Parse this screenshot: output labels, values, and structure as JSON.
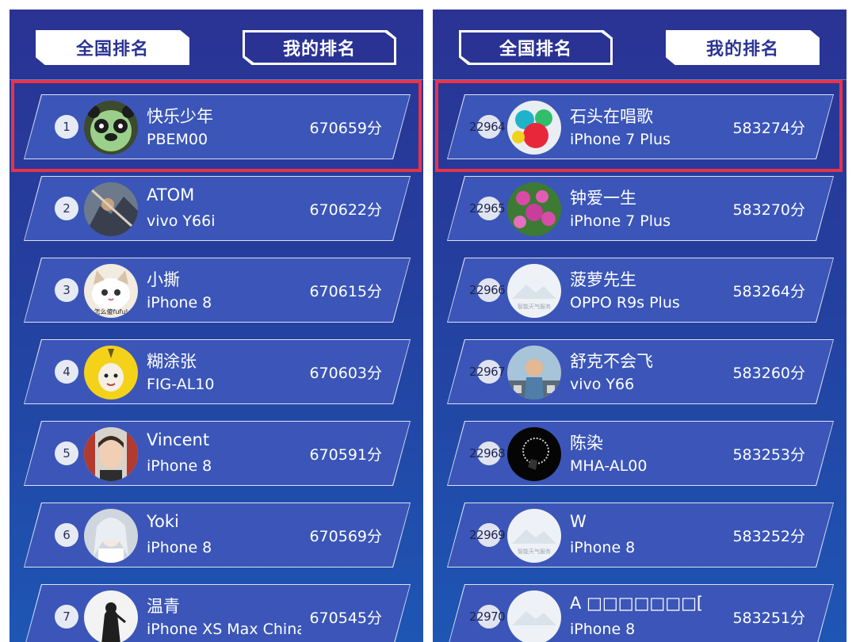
{
  "tabs": {
    "national": "全国排名",
    "mine": "我的排名"
  },
  "left_list": [
    {
      "rank": "1",
      "name": "快乐少年",
      "device": "PBEM00",
      "score": "670659分",
      "avatar": "panda-avatar"
    },
    {
      "rank": "2",
      "name": "ATOM",
      "device": "vivo Y66i",
      "score": "670622分",
      "avatar": "warrior-avatar"
    },
    {
      "rank": "3",
      "name": "小撕",
      "device": "iPhone 8",
      "score": "670615分",
      "avatar": "cat-avatar",
      "avatar_caption": "怎么傻fufu!"
    },
    {
      "rank": "4",
      "name": "糊涂张",
      "device": "FIG-AL10",
      "score": "670603分",
      "avatar": "banana-hood-avatar"
    },
    {
      "rank": "5",
      "name": "Vincent",
      "device": "iPhone 8",
      "score": "670591分",
      "avatar": "boy-photo-avatar"
    },
    {
      "rank": "6",
      "name": "Yoki",
      "device": "iPhone 8",
      "score": "670569分",
      "avatar": "costume-avatar"
    },
    {
      "rank": "7",
      "name": "温青",
      "device": "iPhone XS Max China",
      "score": "670545分",
      "avatar": "silhouette-avatar"
    }
  ],
  "right_list": [
    {
      "rank": "22964",
      "name": "石头在唱歌",
      "device": "iPhone 7 Plus",
      "score": "583274分",
      "avatar": "balloons-avatar"
    },
    {
      "rank": "22965",
      "name": "钟爱一生",
      "device": "iPhone 7 Plus",
      "score": "583270分",
      "avatar": "flowers-avatar"
    },
    {
      "rank": "22966",
      "name": "菠萝先生",
      "device": "OPPO R9s Plus",
      "score": "583264分",
      "avatar": "default-avatar",
      "avatar_caption": "智能天气服务"
    },
    {
      "rank": "22967",
      "name": "舒克不会飞",
      "device": "vivo Y66",
      "score": "583260分",
      "avatar": "cartoon-avatar"
    },
    {
      "rank": "22968",
      "name": "陈染",
      "device": "MHA-AL00",
      "score": "583253分",
      "avatar": "dark-ring-avatar"
    },
    {
      "rank": "22969",
      "name": "W",
      "device": "iPhone 8",
      "score": "583252分",
      "avatar": "default-avatar",
      "avatar_caption": "智能天气服务"
    },
    {
      "rank": "22970",
      "name": "A □□□□□□□[",
      "device": "iPhone 8",
      "score": "583251分",
      "avatar": "default-avatar"
    }
  ],
  "colors": {
    "panel_top": "#2a3394",
    "panel_bottom": "#1e56b4",
    "card": "#3b56b8",
    "highlight": "#e8334a"
  }
}
